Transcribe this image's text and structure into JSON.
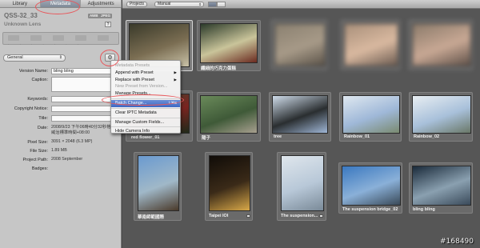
{
  "inspector": {
    "tabs": [
      "Library",
      "Metadata",
      "Adjustments"
    ],
    "camera_name": "QSS-32_33",
    "lens": "Unknown Lens",
    "chips": [
      "AWB",
      "JPEG"
    ],
    "help_label": "?",
    "preset": {
      "value": "General"
    },
    "gear_glyph": "⚙",
    "fields": [
      {
        "label": "Version Name:",
        "value": "bling bling",
        "kind": "input"
      },
      {
        "label": "Caption:",
        "value": "",
        "kind": "area"
      },
      {
        "label": "Keywords:",
        "value": "",
        "kind": "input"
      },
      {
        "label": "Copyright Notice:",
        "value": "",
        "kind": "input"
      },
      {
        "label": "Title:",
        "value": "",
        "kind": "input"
      },
      {
        "label": "Date:",
        "value": "2008/9/23 下午06時40分32秒格林威治標準時間+08:00",
        "kind": "text"
      },
      {
        "label": "Pixel Size:",
        "value": "3091 × 2048 (6.3 MP)",
        "kind": "text"
      },
      {
        "label": "File Size:",
        "value": "1.89 MB",
        "kind": "text"
      },
      {
        "label": "Project Path:",
        "value": "2008 September",
        "kind": "text"
      },
      {
        "label": "Badges:",
        "value": "",
        "kind": "text"
      }
    ]
  },
  "menu": {
    "items": [
      {
        "label": "Metadata Presets",
        "disabled": true
      },
      {
        "label": "Append with Preset",
        "submenu": true
      },
      {
        "label": "Replace with Preset",
        "submenu": true
      },
      {
        "label": "New Preset from Version...",
        "disabled": true
      },
      {
        "label": "Manage Presets..."
      },
      {
        "sep": true
      },
      {
        "label": "Batch Change...",
        "shortcut": "⇧⌘B",
        "selected": true
      },
      {
        "sep": true
      },
      {
        "label": "Clear IPTC Metadata"
      },
      {
        "sep": true
      },
      {
        "label": "Manage Custom Fields..."
      },
      {
        "sep": true
      },
      {
        "label": "Hide Camera Info"
      }
    ]
  },
  "toolbar": {
    "projects_label": "Projects",
    "view_select": "Manual"
  },
  "grid": [
    {
      "caption": "",
      "colors": [
        "#3a3a2a",
        "#7a6d52",
        "#c9c2a8"
      ]
    },
    {
      "caption": "纖細的巧克力蛋糕",
      "colors": [
        "#2b3a2a",
        "#c9c49a",
        "#6b2a20"
      ]
    },
    {
      "caption": "",
      "colors": [
        "#8a8070",
        "#a79a88",
        "#5a5248"
      ],
      "blur": true
    },
    {
      "caption": "",
      "colors": [
        "#a88f7a",
        "#d9b9a0",
        "#6a5a50"
      ],
      "blur": true
    },
    {
      "caption": "",
      "colors": [
        "#8a7a6a",
        "#c8a894",
        "#5e5048"
      ],
      "blur": true
    },
    {
      "caption": "red flower_01",
      "colors": [
        "#3a4a30",
        "#7a2420",
        "#1f2a1a"
      ]
    },
    {
      "caption": "陽子",
      "colors": [
        "#6a8a5a",
        "#3f5a38",
        "#a8a090"
      ]
    },
    {
      "caption": "tree",
      "colors": [
        "#cfdcea",
        "#2a2e30",
        "#9fb6d6"
      ]
    },
    {
      "caption": "Rainbow_01",
      "colors": [
        "#dfe8f0",
        "#9fb8d8",
        "#7a8a70"
      ]
    },
    {
      "caption": "Rainbow_02",
      "colors": [
        "#e8eef2",
        "#a8c0da",
        "#6a7868"
      ]
    },
    {
      "caption": "華南師範國際",
      "colors": [
        "#6a9ad0",
        "#a0b8c8",
        "#4a3a2a"
      ]
    },
    {
      "caption": "Taipei IOI",
      "colors": [
        "#100c08",
        "#3a2a18",
        "#d8a848"
      ]
    },
    {
      "caption": "The suspension...",
      "colors": [
        "#dfe6ec",
        "#b8c8d8",
        "#7a8a98"
      ]
    },
    {
      "caption": "The suspension bridge_02",
      "colors": [
        "#3a78c0",
        "#8ab0d8",
        "#3a4a58"
      ]
    },
    {
      "caption": "bling bling",
      "colors": [
        "#1a2a3a",
        "#8aa0b0",
        "#3a4a5a"
      ]
    }
  ],
  "watermark": "#168490"
}
